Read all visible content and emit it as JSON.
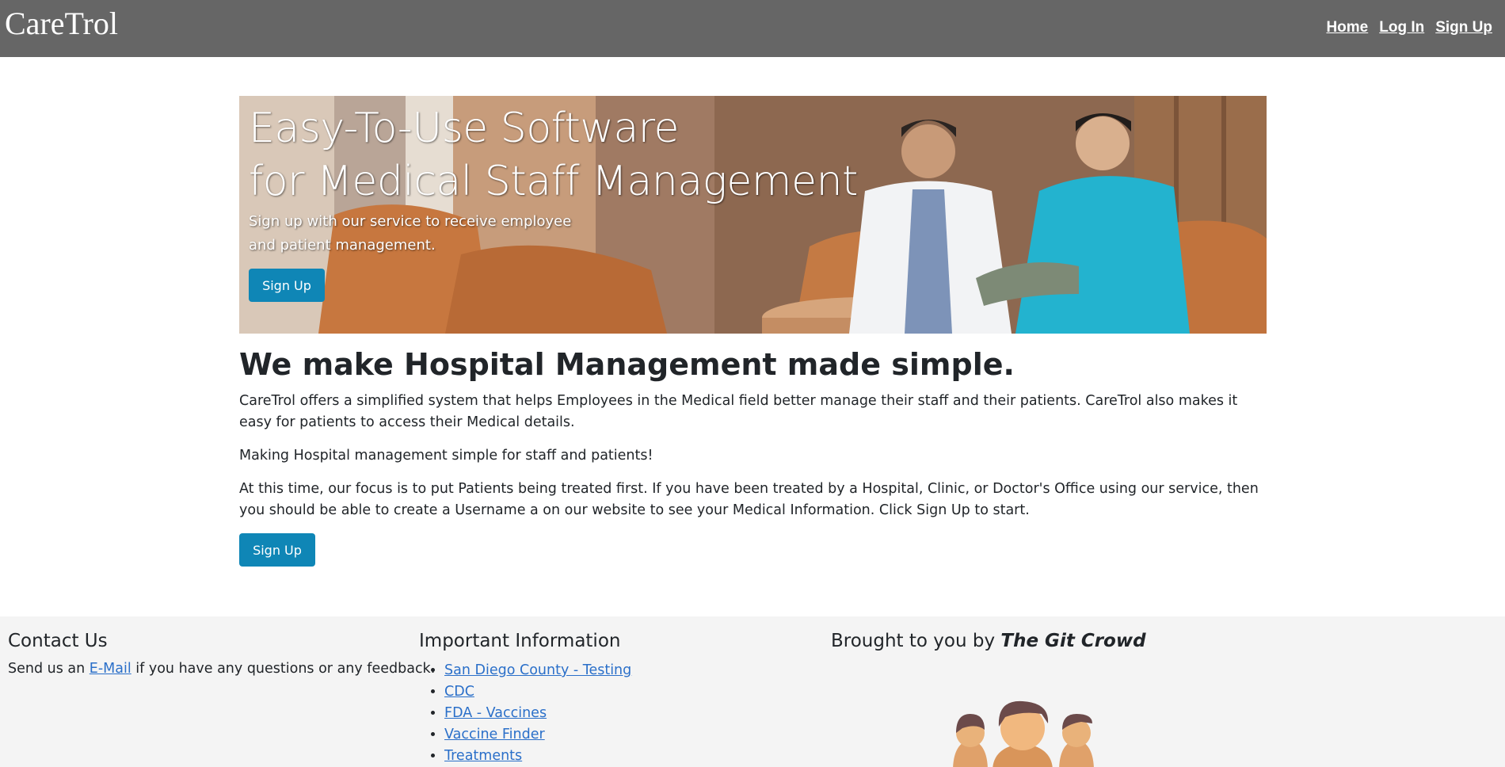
{
  "header": {
    "brand": "CareTrol",
    "nav": [
      "Home",
      "Log In",
      "Sign Up"
    ]
  },
  "hero": {
    "title": "Easy-To-Use Software\nfor Medical Staff Management",
    "subtitle": "Sign up with our service to receive employee\nand patient management.",
    "button": "Sign Up"
  },
  "intro": {
    "title": "We make Hospital Management made simple.",
    "paragraphs": [
      "CareTrol offers a simplified system that helps Employees in the Medical field better manage their staff and their patients. CareTrol also makes it easy for patients to access their Medical details.",
      "Making Hospital management simple for staff and patients!",
      "At this time, our focus is to put Patients being treated first. If you have been treated by a Hospital, Clinic, or Doctor's Office using our service, then you should be able to create a Username a on our website to see your Medical Information. Click Sign Up to start."
    ],
    "button": "Sign Up"
  },
  "footer": {
    "contact": {
      "heading": "Contact Us",
      "text_before": "Send us an ",
      "link": "E-Mail",
      "text_after": " if you have any questions or any feedback."
    },
    "info": {
      "heading": "Important Information",
      "links": [
        "San Diego County - Testing",
        "CDC",
        "FDA - Vaccines",
        "Vaccine Finder",
        "Treatments"
      ]
    },
    "credit": {
      "prefix": "Brought to you by ",
      "name": "The Git Crowd"
    }
  },
  "colors": {
    "navbar": "#666666",
    "button": "#0f86b6",
    "link": "#2a6fc9",
    "footer_bg": "#f4f4f4"
  }
}
